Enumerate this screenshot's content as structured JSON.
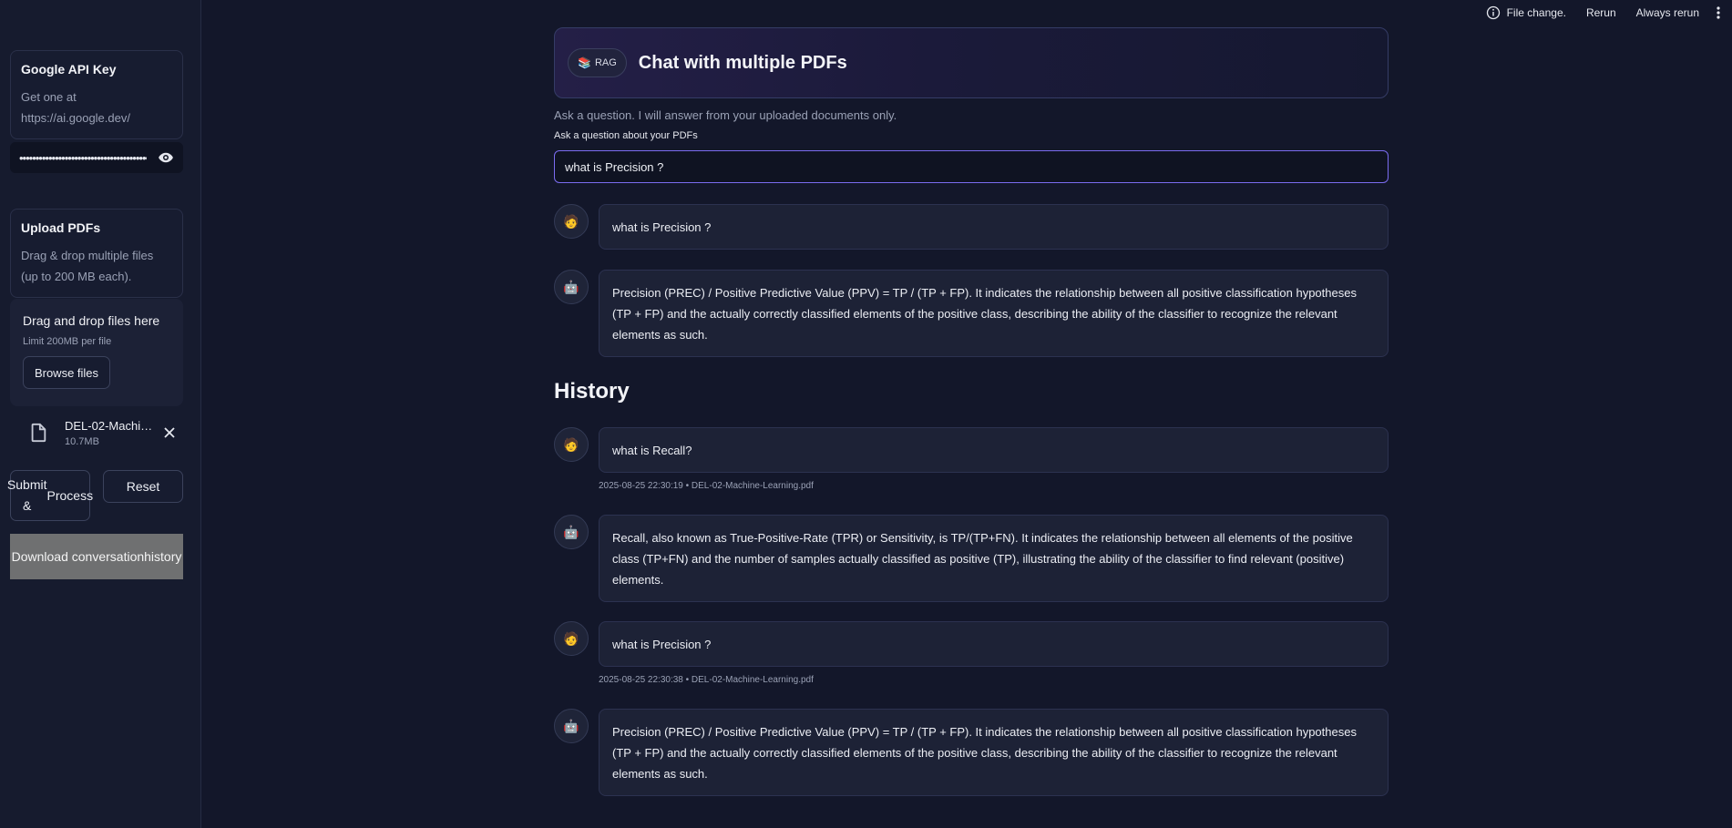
{
  "toolbar": {
    "file_change": "File change.",
    "rerun": "Rerun",
    "always_rerun": "Always rerun"
  },
  "sidebar": {
    "api_card": {
      "title": "Google API Key",
      "text_line1": "Get one at",
      "text_line2": "https://ai.google.dev/"
    },
    "api_key_masked": "••••••••••••••••••••••••••••••••••••••••",
    "upload_card": {
      "title": "Upload PDFs",
      "text_line1": "Drag & drop multiple files",
      "text_line2": "(up to 200 MB each)."
    },
    "dropzone": {
      "title": "Drag and drop files here",
      "limit": "Limit 200MB per file",
      "browse_label": "Browse files"
    },
    "file": {
      "name": "DEL-02-Machine-Learning.pdf",
      "size": "10.7MB"
    },
    "submit_line1": "Submit &",
    "submit_line2": "Process",
    "reset_label": "Reset",
    "download_line1": "Download conversation",
    "download_line2": "history"
  },
  "header": {
    "badge": "RAG",
    "title": "Chat with multiple PDFs"
  },
  "subtitle": "Ask a question. I will answer from your uploaded documents only.",
  "question": {
    "label": "Ask a question about your PDFs",
    "value": "what is Precision ?"
  },
  "current_chat": {
    "user": "what is Precision ?",
    "bot": "Precision (PREC) / Positive Predictive Value (PPV) = TP / (TP + FP). It indicates the relationship between all positive classification hypotheses (TP + FP) and the actually correctly classified elements of the positive class, describing the ability of the classifier to recognize the relevant elements as such."
  },
  "history": {
    "title": "History",
    "items": [
      {
        "user": "what is Recall?",
        "meta": "2025-08-25 22:30:19 • DEL-02-Machine-Learning.pdf",
        "bot": "Recall, also known as True-Positive-Rate (TPR) or Sensitivity, is TP/(TP+FN). It indicates the relationship between all elements of the positive class (TP+FN) and the number of samples actually classified as positive (TP), illustrating the ability of the classifier to find relevant (positive) elements."
      },
      {
        "user": "what is Precision ?",
        "meta": "2025-08-25 22:30:38 • DEL-02-Machine-Learning.pdf",
        "bot": "Precision (PREC) / Positive Predictive Value (PPV) = TP / (TP + FP). It indicates the relationship between all positive classification hypotheses (TP + FP) and the actually correctly classified elements of the positive class, describing the ability of the classifier to recognize the relevant elements as such."
      }
    ]
  },
  "icons": {
    "user_avatar": "🧑",
    "bot_avatar": "🤖",
    "badge_icon": "📚"
  }
}
